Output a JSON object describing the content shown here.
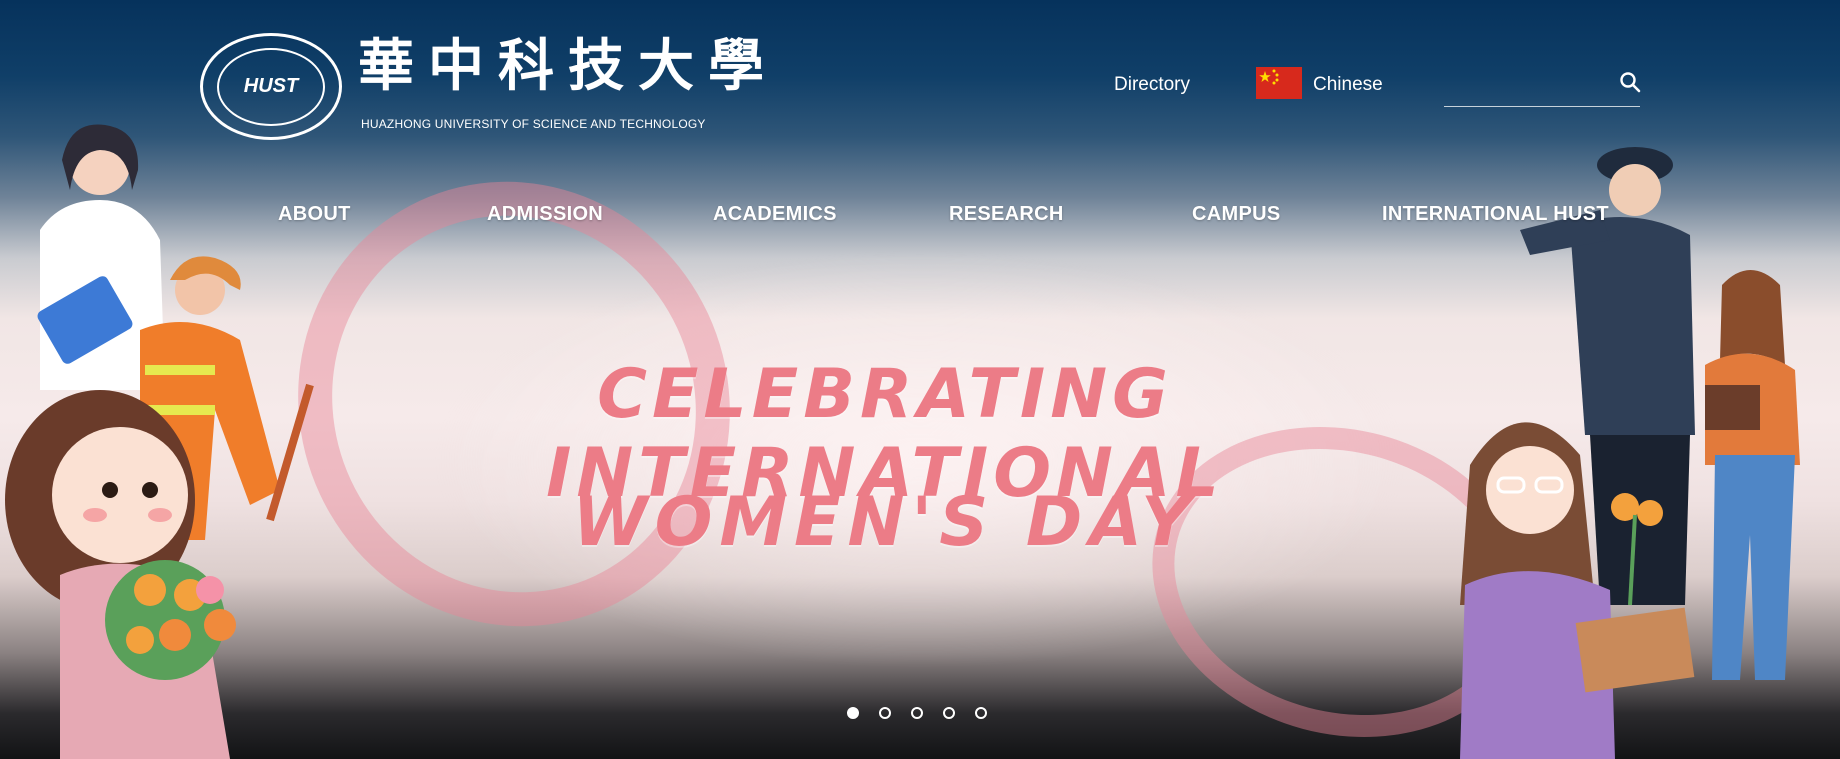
{
  "brand": {
    "name_cn": "華中科技大學",
    "name_en": "HUAZHONG UNIVERSITY OF SCIENCE AND TECHNOLOGY",
    "seal_text": "HUST"
  },
  "utility": {
    "directory_label": "Directory",
    "language_label": "Chinese",
    "search_placeholder": "",
    "flag_icon": "china-flag-icon"
  },
  "nav": {
    "items": [
      {
        "label": "ABOUT"
      },
      {
        "label": "ADMISSION"
      },
      {
        "label": "ACADEMICS"
      },
      {
        "label": "RESEARCH"
      },
      {
        "label": "CAMPUS"
      },
      {
        "label": "INTERNATIONAL HUST"
      }
    ]
  },
  "slide": {
    "headline_line1": "CELEBRATING INTERNATIONAL",
    "headline_line2": "WOMEN'S DAY",
    "accent_color": "#ec7c87"
  },
  "carousel": {
    "total": 5,
    "active_index": 0
  }
}
